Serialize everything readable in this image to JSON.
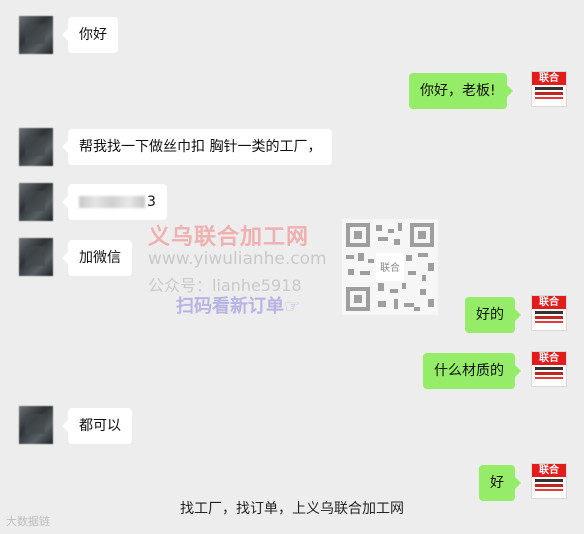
{
  "messages": {
    "m1": "你好",
    "m2": "你好，老板!",
    "m3": "帮我找一下做丝巾扣 胸针一类的工厂，",
    "m4_visible_end": "3",
    "m5": "加微信",
    "m6": "好的",
    "m7": "什么材质的",
    "m8": "都可以",
    "m9": "好"
  },
  "avatar_brand": "联合",
  "watermark": {
    "title": "义乌联合加工网",
    "url": "www.yiwulianhe.com",
    "public": "公众号：lianhe5918",
    "scan": "扫码看新订单☞",
    "qr_center": "联合"
  },
  "footer": "找工厂，找订单，上义乌联合加工网",
  "corner_mark": "大数据链",
  "colors": {
    "background": "#ededed",
    "incoming_bubble": "#ffffff",
    "outgoing_bubble": "#95ec69",
    "brand_red": "#e21b1b"
  }
}
